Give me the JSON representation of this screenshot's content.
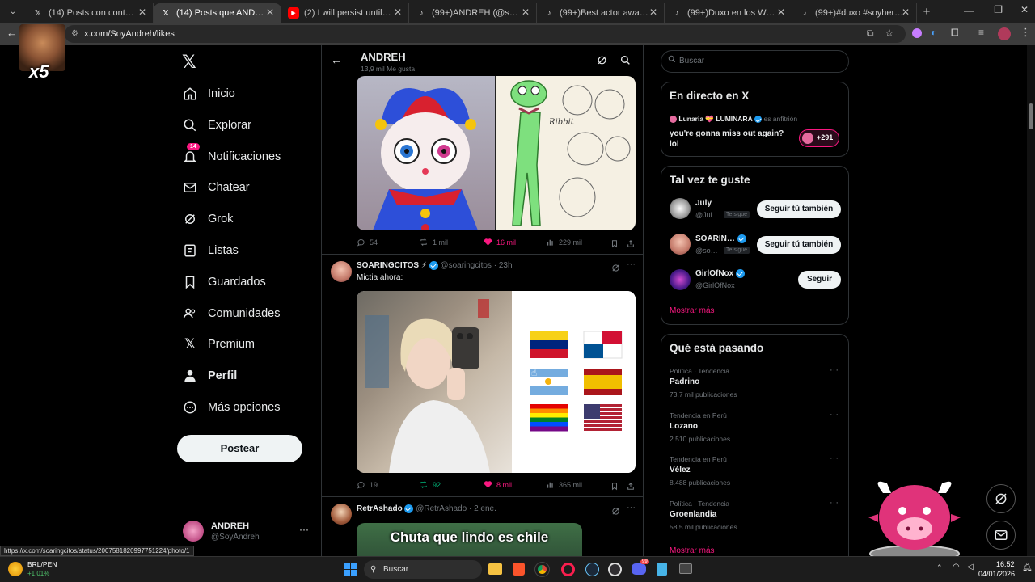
{
  "browser": {
    "tabs": [
      {
        "title": "(14) Posts con contenido multim…",
        "fav": "x-logo"
      },
      {
        "title": "(14) Posts que ANDREH (@Soy…",
        "fav": "x-logo",
        "active": true
      },
      {
        "title": "(2) I will persist until succes…",
        "fav": "youtube-icon"
      },
      {
        "title": "(99+)ANDREH (@soyandreh) |…",
        "fav": "tiktok-icon"
      },
      {
        "title": "(99+)Best actor award#fyp #ki…",
        "fav": "tiktok-icon"
      },
      {
        "title": "(99+)Duxo en los Webones Aw…",
        "fav": "tiktok-icon"
      },
      {
        "title": "(99+)#duxo #soyhero #pili | el…",
        "fav": "tiktok-icon"
      }
    ],
    "url": "x.com/SoyAndreh/likes",
    "status_url": "https://x.com/soaringcitos/status/2007581820997751224/photo/1"
  },
  "overlay": {
    "multiplier": "x5"
  },
  "nav": {
    "items": [
      {
        "label": "Inicio",
        "icon": "home-icon"
      },
      {
        "label": "Explorar",
        "icon": "search-icon"
      },
      {
        "label": "Notificaciones",
        "icon": "bell-icon",
        "badge": "14"
      },
      {
        "label": "Chatear",
        "icon": "mail-icon"
      },
      {
        "label": "Grok",
        "icon": "grok-icon"
      },
      {
        "label": "Listas",
        "icon": "list-icon"
      },
      {
        "label": "Guardados",
        "icon": "bookmark-icon"
      },
      {
        "label": "Comunidades",
        "icon": "people-icon"
      },
      {
        "label": "Premium",
        "icon": "x-logo"
      },
      {
        "label": "Perfil",
        "icon": "person-icon"
      },
      {
        "label": "Más opciones",
        "icon": "more-circle-icon"
      }
    ],
    "post_label": "Postear",
    "account": {
      "name": "ANDREH",
      "handle": "@SoyAndreh"
    }
  },
  "header": {
    "name": "ANDREH",
    "likes": "13,9 mil Me gusta"
  },
  "posts": [
    {
      "replies": "54",
      "reposts": "1 mil",
      "likes": "16 mil",
      "views": "229 mil",
      "frog_caption": "Ribbit"
    },
    {
      "author": "SOARINGCITOS ⚡",
      "handle": "@soaringcitos · 23h",
      "text": "Mictia ahora:",
      "replies": "19",
      "reposts": "92",
      "likes": "8 mil",
      "views": "365 mil"
    },
    {
      "author": "RetrAshado",
      "handle": "@RetrAshado · 2 ene.",
      "image_text": "Chuta que lindo es chile"
    }
  ],
  "search": {
    "placeholder": "Buscar"
  },
  "live": {
    "title": "En directo en X",
    "host": "Lunaria 💝 LUMINARA",
    "host_suffix": "es anfitrión",
    "text": "you're gonna miss out again? lol",
    "count": "+291"
  },
  "suggestions": {
    "title": "Tal vez te guste",
    "users": [
      {
        "name": "July",
        "handle": "@Jul…",
        "follows_you": "Te sigue",
        "button": "Seguir tú también"
      },
      {
        "name": "SOARIN…",
        "handle": "@so…",
        "follows_you": "Te sigue",
        "button": "Seguir tú también"
      },
      {
        "name": "GirlOfNox",
        "handle": "@GirlOfNox",
        "button": "Seguir"
      }
    ],
    "more": "Mostrar más"
  },
  "trends": {
    "title": "Qué está pasando",
    "items": [
      {
        "category": "Política · Tendencia",
        "name": "Padrino",
        "count": "73,7 mil publicaciones"
      },
      {
        "category": "Tendencia en Perú",
        "name": "Lozano",
        "count": "2.510 publicaciones"
      },
      {
        "category": "Tendencia en Perú",
        "name": "Vélez",
        "count": "8.488 publicaciones"
      },
      {
        "category": "Política · Tendencia",
        "name": "Groenlandia",
        "count": "58,5 mil publicaciones"
      }
    ],
    "more": "Mostrar más"
  },
  "taskbar": {
    "stock_name": "BRL/PEN",
    "stock_change": "+1,01%",
    "search": "Buscar",
    "time": "16:52",
    "date": "04/01/2026",
    "discord_badge": "99"
  },
  "colors": {
    "like": "#f91880",
    "repost": "#00ba7c",
    "link": "#f91880",
    "verified": "#1d9bf0"
  }
}
